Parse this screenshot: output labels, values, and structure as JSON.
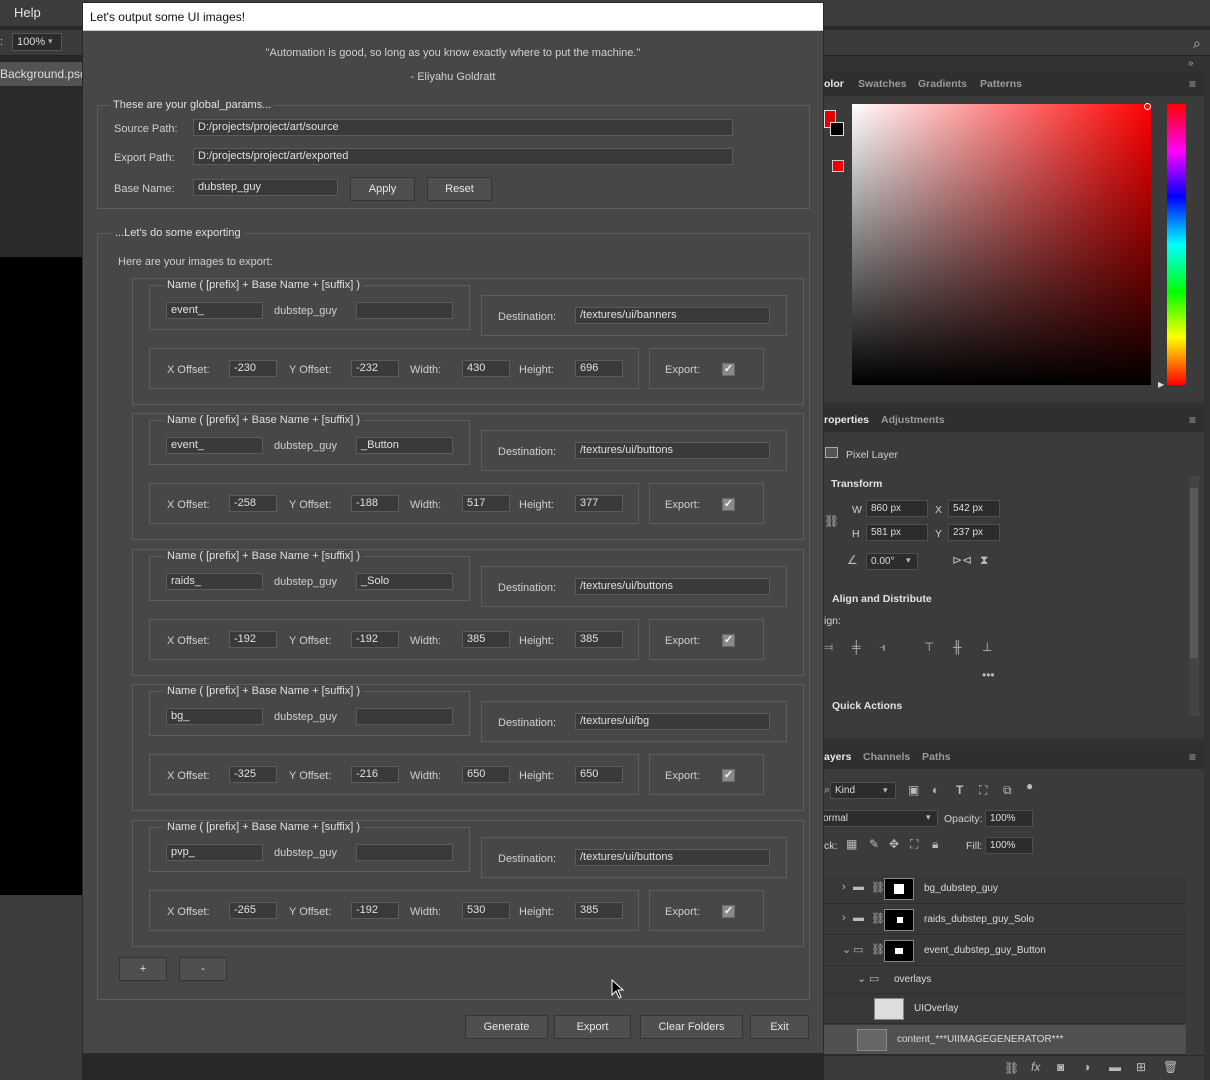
{
  "photoshop": {
    "menu_help": "Help",
    "zoom_label": ":",
    "zoom_value": "100%",
    "doc_tab": "Background.psd",
    "color_tabs": [
      "olor",
      "Swatches",
      "Gradients",
      "Patterns"
    ],
    "props_tabs": [
      "roperties",
      "Adjustments"
    ],
    "pixel_layer": "Pixel Layer",
    "transform_label": "Transform",
    "w_label": "W",
    "w_value": "860 px",
    "h_label": "H",
    "h_value": "581 px",
    "x_label": "X",
    "x_value": "542 px",
    "y_label": "Y",
    "y_value": "237 px",
    "angle_value": "0.00°",
    "align_label": "Align and Distribute",
    "align_sub": "ign:",
    "quick_actions": "Quick Actions",
    "layers_tabs": [
      "ayers",
      "Channels",
      "Paths"
    ],
    "kind_label": "Kind",
    "blend_mode": "ormal",
    "opacity_label": "Opacity:",
    "opacity_value": "100%",
    "lock_label": "ck:",
    "fill_label": "Fill:",
    "fill_value": "100%",
    "layers": [
      {
        "name": "bg_dubstep_guy"
      },
      {
        "name": "raids_dubstep_guy_Solo"
      },
      {
        "name": "event_dubstep_guy_Button"
      },
      {
        "name": "overlays"
      },
      {
        "name": "UIOverlay"
      },
      {
        "name": "content_***UIIMAGEGENERATOR***"
      }
    ]
  },
  "tool": {
    "title": "Let's output some UI images!",
    "quote": "\"Automation is good, so long as you know exactly where to put the machine.\"",
    "quote_author": "- Eliyahu Goldratt",
    "global_group": "These are your global_params...",
    "source_label": "Source Path:",
    "source_value": "D:/projects/project/art/source",
    "export_path_label": "Export Path:",
    "export_path_value": "D:/projects/project/art/exported",
    "base_name_label": "Base Name:",
    "base_name_value": "dubstep_guy",
    "apply_label": "Apply",
    "reset_label": "Reset",
    "export_group": "...Let's do some exporting",
    "images_heading": "Here are your images to export:",
    "name_group_title": "Name ( [prefix] + Base Name + [suffix] )",
    "destination_label": "Destination:",
    "x_offset_label": "X Offset:",
    "y_offset_label": "Y Offset:",
    "width_label": "Width:",
    "height_label": "Height:",
    "export_label": "Export:",
    "items": [
      {
        "prefix": "event_",
        "base": "dubstep_guy",
        "suffix": "",
        "destination": "/textures/ui/banners",
        "x": "-230",
        "y": "-232",
        "w": "430",
        "h": "696",
        "export": true
      },
      {
        "prefix": "event_",
        "base": "dubstep_guy",
        "suffix": "_Button",
        "destination": "/textures/ui/buttons",
        "x": "-258",
        "y": "-188",
        "w": "517",
        "h": "377",
        "export": true
      },
      {
        "prefix": "raids_",
        "base": "dubstep_guy",
        "suffix": "_Solo",
        "destination": "/textures/ui/buttons",
        "x": "-192",
        "y": "-192",
        "w": "385",
        "h": "385",
        "export": true
      },
      {
        "prefix": "bg_",
        "base": "dubstep_guy",
        "suffix": "",
        "destination": "/textures/ui/bg",
        "x": "-325",
        "y": "-216",
        "w": "650",
        "h": "650",
        "export": true
      },
      {
        "prefix": "pvp_",
        "base": "dubstep_guy",
        "suffix": "",
        "destination": "/textures/ui/buttons",
        "x": "-265",
        "y": "-192",
        "w": "530",
        "h": "385",
        "export": true
      }
    ],
    "add_label": "+",
    "remove_label": "-",
    "generate_label": "Generate",
    "export_button_label": "Export",
    "clear_label": "Clear Folders",
    "exit_label": "Exit"
  }
}
